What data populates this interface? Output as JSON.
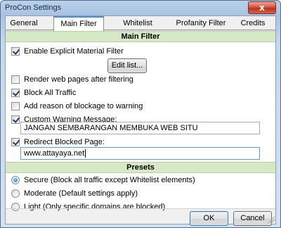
{
  "window": {
    "title": "ProCon Settings",
    "close_glyph": "x"
  },
  "tabs": [
    {
      "label": "General",
      "active": false
    },
    {
      "label": "Main Filter",
      "active": true
    },
    {
      "label": "Whitelist",
      "active": false
    },
    {
      "label": "Profanity Filter",
      "active": false
    },
    {
      "label": "Credits",
      "active": false
    }
  ],
  "main_filter": {
    "header": "Main Filter",
    "options": [
      {
        "label": "Enable Explicit Material Filter",
        "checked": true
      },
      {
        "label": "Render web pages after filtering",
        "checked": false
      },
      {
        "label": "Block All Traffic",
        "checked": true
      },
      {
        "label": "Add reason of blockage to warning",
        "checked": false
      },
      {
        "label": "Custom Warning Message:",
        "checked": true
      },
      {
        "label": "Redirect Blocked Page:",
        "checked": true
      }
    ],
    "edit_list_label": "Edit list...",
    "warning_message_value": "JANGAN SEMBARANGAN MEMBUKA WEB SITU",
    "redirect_value": "www.attayaya.net"
  },
  "presets": {
    "header": "Presets",
    "options": [
      {
        "label": "Secure (Block all traffic except Whitelist elements)",
        "selected": true
      },
      {
        "label": "Moderate (Default settings apply)",
        "selected": false
      },
      {
        "label": "Light (Only specific domains are blocked)",
        "selected": false
      }
    ]
  },
  "footer": {
    "ok_label": "OK",
    "cancel_label": "Cancel"
  }
}
